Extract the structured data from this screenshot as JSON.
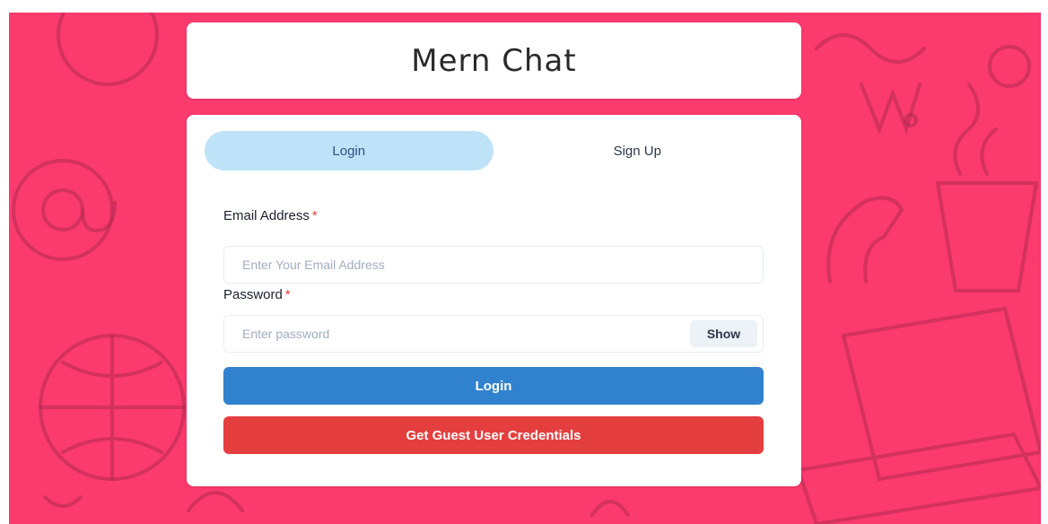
{
  "app": {
    "title": "Mern Chat"
  },
  "tabs": [
    {
      "label": "Login",
      "active": true
    },
    {
      "label": "Sign Up",
      "active": false
    }
  ],
  "form": {
    "email": {
      "label": "Email Address",
      "required_mark": "*",
      "placeholder": "Enter Your Email Address",
      "value": ""
    },
    "password": {
      "label": "Password",
      "required_mark": "*",
      "placeholder": "Enter password",
      "value": "",
      "show_label": "Show"
    },
    "login_button_label": "Login",
    "guest_button_label": "Get Guest User Credentials"
  },
  "colors": {
    "background": "#fb3a6e",
    "active_tab": "#bee3f8",
    "login_button": "#3182ce",
    "guest_button": "#e53e3e",
    "required_mark": "#e53e3e"
  }
}
